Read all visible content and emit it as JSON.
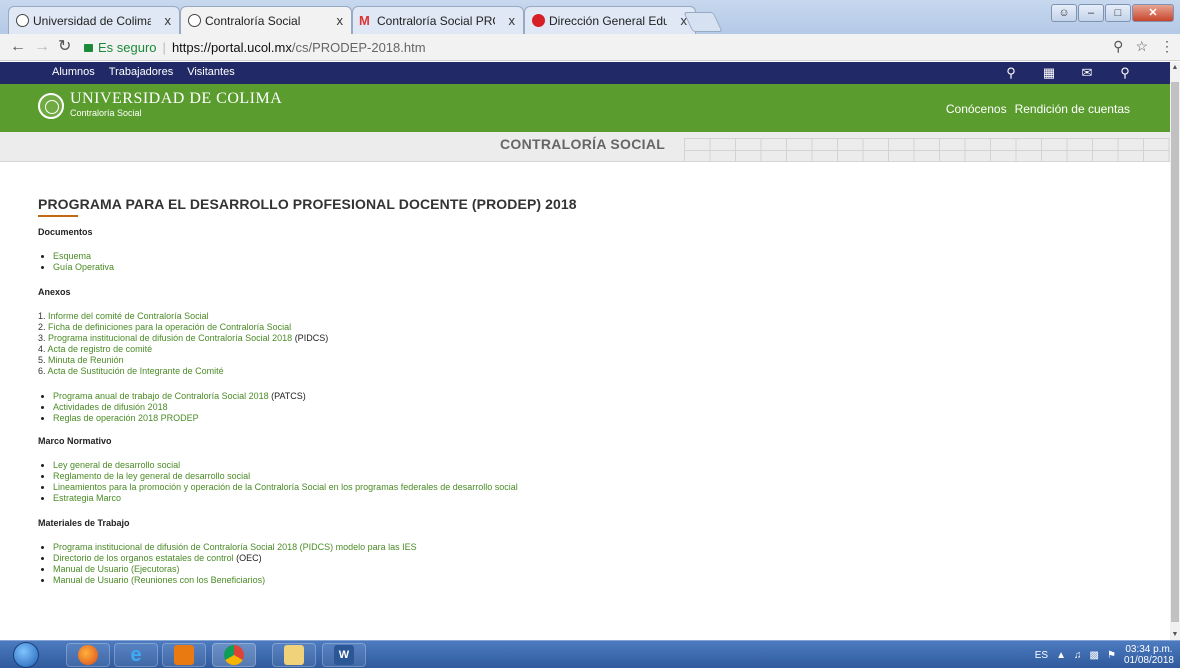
{
  "browser": {
    "tabs": [
      {
        "title": "Universidad de Colima /",
        "icon": "seal-icon"
      },
      {
        "title": "Contraloría Social",
        "icon": "seal-icon",
        "active": true
      },
      {
        "title": "Contraloría Social PRODE",
        "icon": "gmail-icon"
      },
      {
        "title": "Dirección General Educac",
        "icon": "red-circle-icon"
      }
    ],
    "address": {
      "secure_label": "Es seguro",
      "host": "https://portal.ucol.mx",
      "path": "/cs/PRODEP-2018.htm"
    },
    "window_controls": [
      "minimize",
      "maximize",
      "close"
    ],
    "close_glyph": "x"
  },
  "site": {
    "topnav": [
      "Alumnos",
      "Trabajadores",
      "Visitantes"
    ],
    "topnav_icons": [
      "person-pin-icon",
      "calendar-icon",
      "mail-icon",
      "search-icon"
    ],
    "logo": {
      "main": "UNIVERSIDAD DE COLIMA",
      "sub": "Contraloría Social"
    },
    "green_links": [
      "Conócenos",
      "Rendición de cuentas"
    ],
    "section_title": "CONTRALORÍA SOCIAL",
    "accent_color": "#5b9c2e",
    "nav_color": "#212a67"
  },
  "content": {
    "title": "PROGRAMA PARA EL DESARROLLO PROFESIONAL DOCENTE (PRODEP) 2018",
    "documentos": {
      "heading": "Documentos",
      "items": [
        "Esquema",
        "Guía Operativa"
      ]
    },
    "anexos": {
      "heading": "Anexos",
      "numbered": [
        {
          "n": "1.",
          "text": "Informe del comité de Contraloría Social",
          "suffix": ""
        },
        {
          "n": "2.",
          "text": "Ficha de definiciones para la operación de Contraloría Social",
          "suffix": ""
        },
        {
          "n": "3.",
          "text": "Programa institucional de difusión de Contraloría Social 2018",
          "suffix": " (PIDCS)"
        },
        {
          "n": "4.",
          "text": "Acta de registro de comité",
          "suffix": ""
        },
        {
          "n": "5.",
          "text": "Minuta de Reunión",
          "suffix": ""
        },
        {
          "n": "6.",
          "text": "Acta de Sustitución de Integrante de Comité",
          "suffix": ""
        }
      ],
      "bullets": [
        {
          "text": "Programa anual de trabajo de Contraloría Social 2018",
          "suffix": " (PATCS)"
        },
        {
          "text": "Actividades de difusión 2018",
          "suffix": ""
        },
        {
          "text": "Reglas de operación 2018 PRODEP",
          "suffix": ""
        }
      ]
    },
    "marco": {
      "heading": "Marco Normativo",
      "items": [
        "Ley general de desarrollo social",
        "Reglamento de la ley general de desarrollo social",
        "Lineamientos para la promoción y operación de la Contraloría Social en los programas federales de desarrollo social",
        "Estrategia Marco"
      ]
    },
    "materiales": {
      "heading": "Materiales de Trabajo",
      "items": [
        {
          "text": "Programa institucional de difusión de Contraloría Social 2018 (PIDCS) modelo para las IES",
          "suffix": ""
        },
        {
          "text": "Directorio de los organos estatales de control",
          "suffix": " (OEC)"
        },
        {
          "text": "Manual de Usuario (Ejecutoras)",
          "suffix": ""
        },
        {
          "text": "Manual de Usuario (Reuniones con los Beneficiarios)",
          "suffix": ""
        }
      ]
    }
  },
  "taskbar": {
    "apps": [
      "start-orb",
      "firefox-icon",
      "internet-explorer-icon",
      "outlook-icon",
      "chrome-icon",
      "file-explorer-icon",
      "word-icon"
    ],
    "language": "ES",
    "time": "03:34 p.m.",
    "date": "01/08/2018"
  }
}
